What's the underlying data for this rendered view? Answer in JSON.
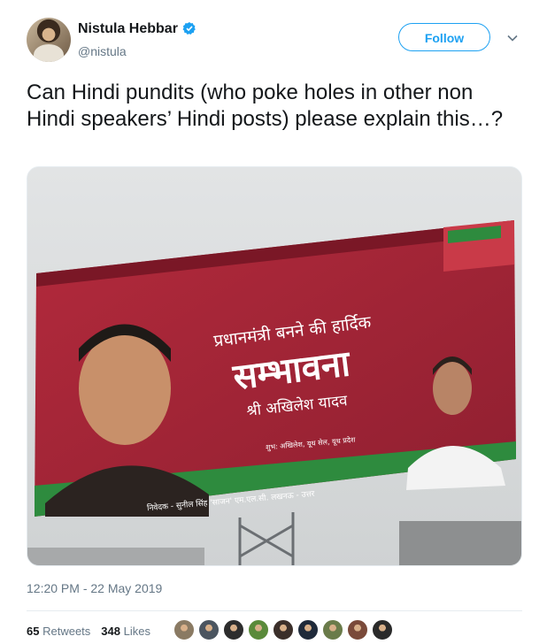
{
  "author": {
    "name": "Nistula Hebbar",
    "handle": "@nistula",
    "verified": true
  },
  "actions": {
    "follow_label": "Follow"
  },
  "tweet": {
    "text": "Can Hindi pundits (who poke holes in other non Hindi speakers’ Hindi posts) please explain this…?",
    "timestamp": "12:20 PM - 22 May 2019"
  },
  "billboard": {
    "line1": "प्रधानमंत्री बनने की हार्दिक",
    "line2": "सम्भावना",
    "line3": "श्री अखिलेश यादव",
    "small": "शुभ: अखिलेश, यूथ सेल, यूथ प्रदेश",
    "bottom": "निवेदक - सुनील सिंह 'साजन' एम.एल.सी. लखनऊ - उत्तर"
  },
  "stats": {
    "retweets_count": "65",
    "retweets_label": "Retweets",
    "likes_count": "348",
    "likes_label": "Likes"
  },
  "likers": [
    "#8a7a63",
    "#4b5560",
    "#2d2d2d",
    "#5a8a3a",
    "#3b2f2a",
    "#1f2a3a",
    "#6a7b4a",
    "#7a4a3a",
    "#2a2a2a"
  ],
  "colors": {
    "accent": "#1da1f2",
    "billboard_red": "#a8263a",
    "billboard_green": "#2e8b3e"
  }
}
